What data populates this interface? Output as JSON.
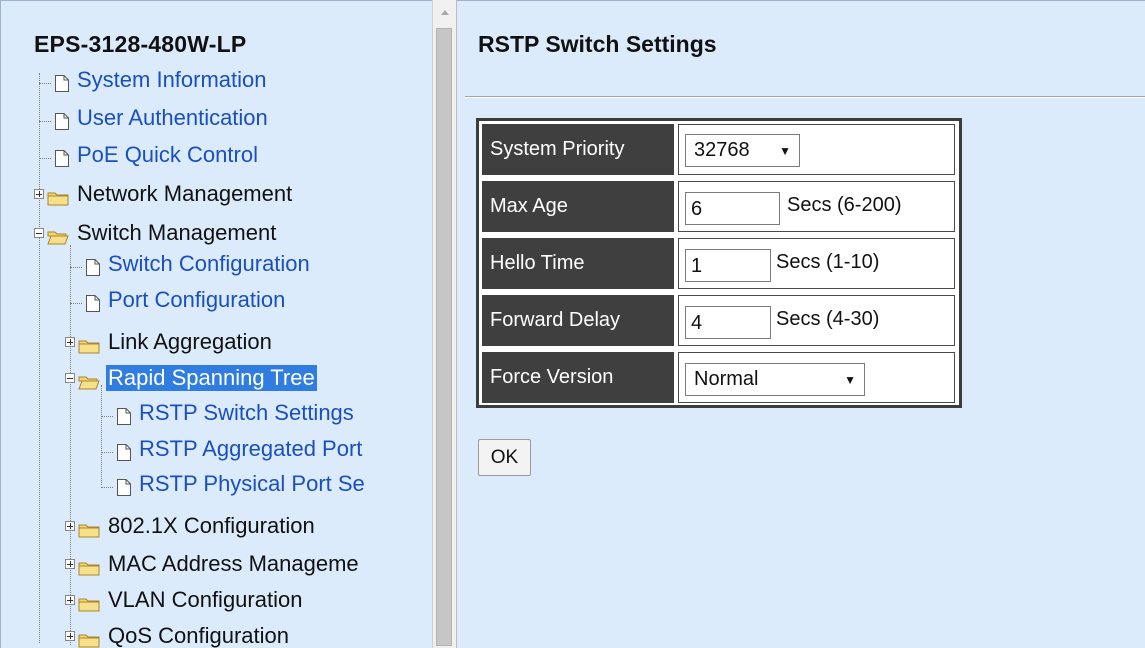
{
  "tree": {
    "device_title": "EPS-3128-480W-LP",
    "items": [
      {
        "label": "System Information",
        "type": "page"
      },
      {
        "label": "User Authentication",
        "type": "page"
      },
      {
        "label": "PoE Quick Control",
        "type": "page"
      },
      {
        "label": "Network Management",
        "type": "folder",
        "expanded": false
      },
      {
        "label": "Switch Management",
        "type": "folder",
        "expanded": true,
        "children": [
          {
            "label": "Switch Configuration",
            "type": "page"
          },
          {
            "label": "Port Configuration",
            "type": "page"
          },
          {
            "label": "Link Aggregation",
            "type": "folder",
            "expanded": false
          },
          {
            "label": "Rapid Spanning Tree",
            "type": "folder",
            "expanded": true,
            "selected": true,
            "children": [
              {
                "label": "RSTP Switch Settings",
                "type": "page"
              },
              {
                "label": "RSTP Aggregated Port",
                "type": "page"
              },
              {
                "label": "RSTP Physical Port Se",
                "type": "page"
              }
            ]
          },
          {
            "label": "802.1X Configuration",
            "type": "folder",
            "expanded": false
          },
          {
            "label": "MAC Address Manageme",
            "type": "folder",
            "expanded": false
          },
          {
            "label": "VLAN Configuration",
            "type": "folder",
            "expanded": false
          },
          {
            "label": "QoS Configuration",
            "type": "folder",
            "expanded": false
          }
        ]
      }
    ]
  },
  "main": {
    "title": "RSTP Switch Settings",
    "settings": {
      "system_priority": {
        "label": "System Priority",
        "value": "32768"
      },
      "max_age": {
        "label": "Max Age",
        "value": "6",
        "hint": "Secs (6-200)"
      },
      "hello_time": {
        "label": "Hello Time",
        "value": "1",
        "hint": "Secs (1-10)"
      },
      "forward_delay": {
        "label": "Forward Delay",
        "value": "4",
        "hint": "Secs (4-30)"
      },
      "force_version": {
        "label": "Force Version",
        "value": "Normal"
      }
    },
    "ok_label": "OK"
  },
  "colors": {
    "panel_bg": "#dcebfb",
    "link": "#1a4fc0",
    "selected_bg": "#2f7de1",
    "table_label_bg": "#3f3f3f"
  },
  "icons": {
    "page": "document-icon",
    "folder": "folder-icon",
    "expander": "plus-minus-box"
  }
}
